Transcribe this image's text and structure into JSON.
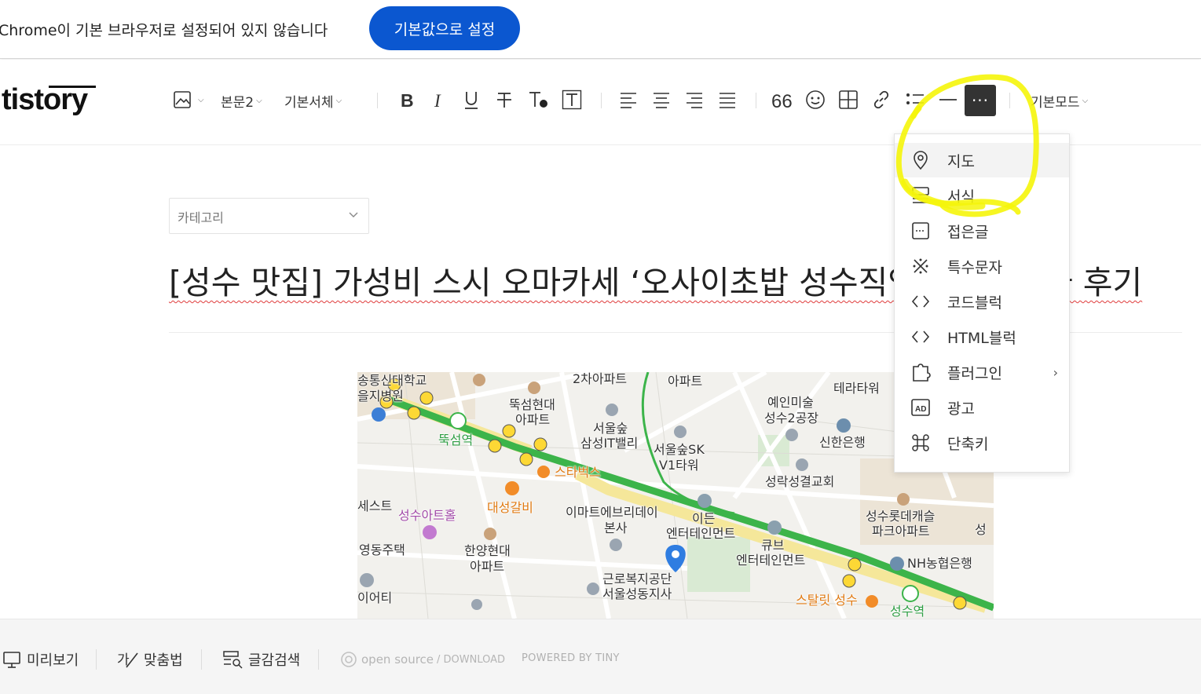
{
  "infobar": {
    "message": "Chrome이 기본 브라우저로 설정되어 있지 않습니다",
    "button_label": "기본값으로 설정"
  },
  "header": {
    "logo": "tistory",
    "paragraph_style": "본문2",
    "font": "기본서체",
    "mode": "기본모드",
    "more_label": "···"
  },
  "category": {
    "label": "카테고리"
  },
  "post": {
    "title": "[성수 맛집] 가성비 스시 오마카세 ‘오사이초밥 성수직영",
    "title_tail": "사 후기"
  },
  "map": {
    "labels": [
      "송통신대학교",
      "을지병원",
      "2차아파트",
      "아파트",
      "테라타워",
      "뚝섬현대",
      "아파트",
      "예인미술",
      "성수2공장",
      "서울숲",
      "삼성IT밸리",
      "서울숲SK",
      "V1타워",
      "신한은행",
      "뚝섬역",
      "스타벅스",
      "성락성결교회",
      "대성갈비",
      "이마트에브리데이",
      "본사",
      "이든",
      "엔터테인먼트",
      "성수롯데캐슬",
      "파크아파트",
      "성수아트홀",
      "한양현대",
      "아파트",
      "큐브",
      "엔터테인먼트",
      "NH농협은행",
      "영동주택",
      "근로복지공단",
      "서울성동지사",
      "스탈릿 성수",
      "성수역",
      "이어티",
      "세스트",
      "성"
    ]
  },
  "menu": {
    "items": [
      {
        "label": "지도",
        "icon": "map-pin-icon"
      },
      {
        "label": "서식",
        "icon": "template-icon"
      },
      {
        "label": "접은글",
        "icon": "fold-icon"
      },
      {
        "label": "특수문자",
        "icon": "special-char-icon"
      },
      {
        "label": "코드블럭",
        "icon": "code-icon"
      },
      {
        "label": "HTML블럭",
        "icon": "html-icon"
      },
      {
        "label": "플러그인",
        "icon": "plugin-icon"
      },
      {
        "label": "광고",
        "icon": "ad-icon"
      },
      {
        "label": "단축키",
        "icon": "command-icon"
      }
    ]
  },
  "footer": {
    "preview": "미리보기",
    "spellcheck": "맞춤법",
    "search": "글감검색",
    "opensource": "open source",
    "download": "/ DOWNLOAD",
    "powered": "POWERED BY TINY"
  },
  "colors": {
    "chrome_button": "#0b57d0",
    "highlight": "#f5f50a",
    "subway_line": "#3cb44a"
  }
}
